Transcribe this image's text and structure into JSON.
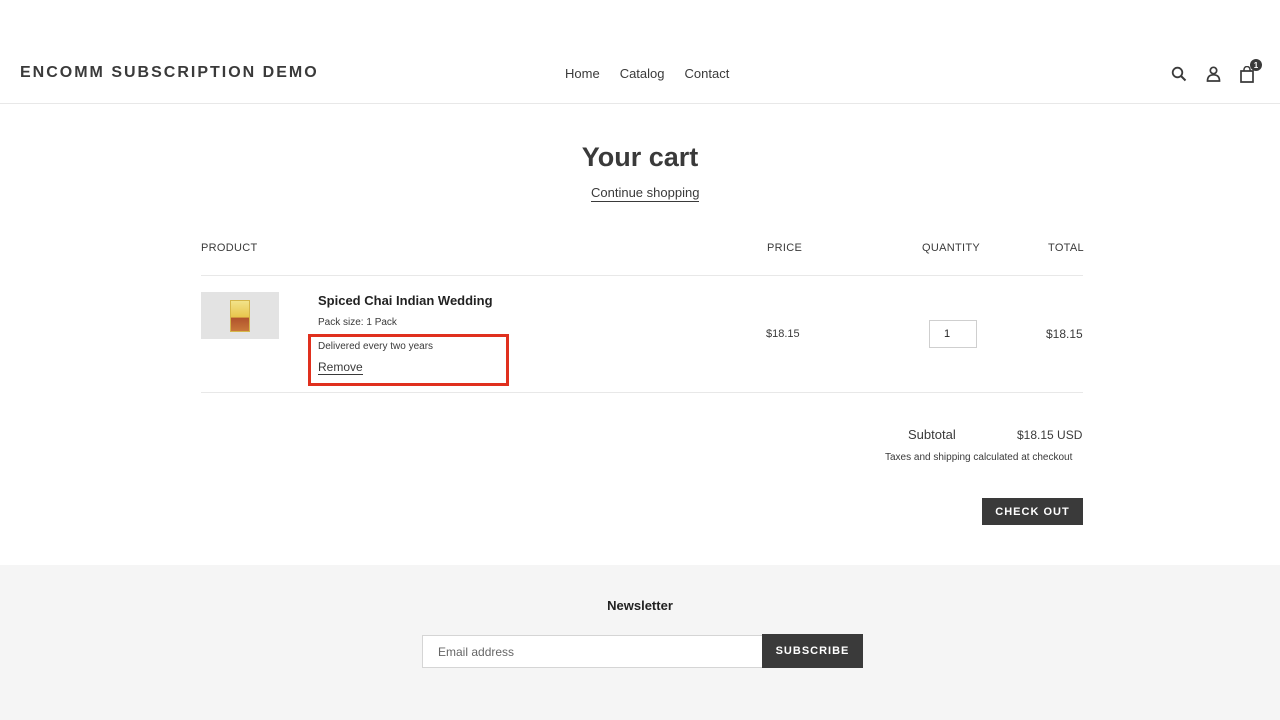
{
  "header": {
    "brand": "ENCOMM SUBSCRIPTION DEMO",
    "nav": [
      "Home",
      "Catalog",
      "Contact"
    ],
    "icons": [
      "search-icon",
      "account-icon",
      "cart-icon"
    ],
    "cart_count": "1"
  },
  "cart": {
    "title": "Your cart",
    "continue_label": "Continue shopping",
    "columns": {
      "product": "PRODUCT",
      "price": "PRICE",
      "quantity": "QUANTITY",
      "total": "TOTAL"
    },
    "items": [
      {
        "name": "Spiced Chai Indian Wedding",
        "pack_size": "Pack size: 1 Pack",
        "delivery": "Delivered every two years",
        "remove_label": "Remove",
        "price": "$18.15",
        "quantity": "1",
        "total": "$18.15"
      }
    ],
    "subtotal_label": "Subtotal",
    "subtotal_value": "$18.15 USD",
    "tax_note": "Taxes and shipping calculated at checkout",
    "checkout_label": "CHECK OUT"
  },
  "newsletter": {
    "title": "Newsletter",
    "email_placeholder": "Email address",
    "subscribe_label": "SUBSCRIBE"
  },
  "colors": {
    "text": "#3a3a3a",
    "button": "#3a3a3a",
    "footer_bg": "#f5f5f5",
    "highlight": "#e0301e"
  }
}
